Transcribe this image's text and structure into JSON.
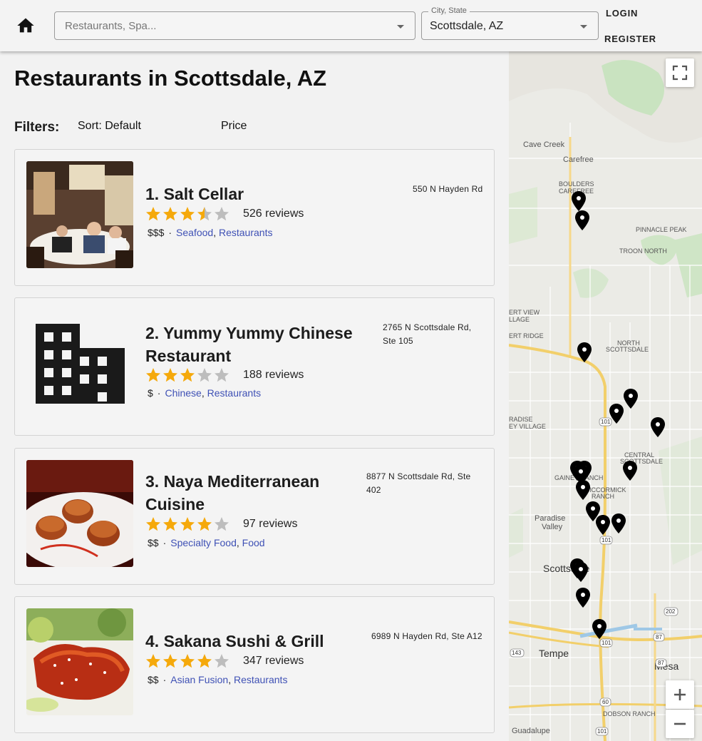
{
  "header": {
    "home_icon": "home-icon",
    "search": {
      "placeholder": "Restaurants, Spa...",
      "value": ""
    },
    "city": {
      "label": "City, State",
      "value": "Scottsdale, AZ"
    },
    "login": "LOGIN",
    "register": "REGISTER"
  },
  "main": {
    "title": "Restaurants in Scottsdale, AZ",
    "filters_label": "Filters:",
    "sort_label": "Sort: Default",
    "price_label": "Price"
  },
  "colors": {
    "star_filled": "#f5a90b",
    "star_empty": "#bdbdbd",
    "link": "#3f51b5",
    "marker": "#000000"
  },
  "results": [
    {
      "name": "1. Salt Cellar",
      "rating": 3.5,
      "reviews": "526 reviews",
      "price": "$$$",
      "categories": [
        "Seafood",
        "Restaurants"
      ],
      "address_line1": "550 N Hayden Rd",
      "address_line2": "",
      "image": "restaurant-dining-room-photo"
    },
    {
      "name": "2. Yummy Yummy Chinese Restaurant",
      "rating": 3,
      "reviews": "188 reviews",
      "price": "$",
      "categories": [
        "Chinese",
        "Restaurants"
      ],
      "address_line1": "2765 N Scottsdale Rd,",
      "address_line2": "Ste 105",
      "image": "building-icon"
    },
    {
      "name": "3. Naya Mediterranean Cuisine",
      "rating": 4,
      "reviews": "97 reviews",
      "price": "$$",
      "categories": [
        "Specialty Food",
        "Food"
      ],
      "address_line1": "8877 N Scottsdale Rd, Ste",
      "address_line2": "402",
      "image": "scallops-dish-photo"
    },
    {
      "name": "4. Sakana Sushi & Grill",
      "rating": 4,
      "reviews": "347 reviews",
      "price": "$$",
      "categories": [
        "Asian Fusion",
        "Restaurants"
      ],
      "address_line1": "6989 N Hayden Rd, Ste A12",
      "address_line2": "",
      "image": "glazed-salmon-salad-photo"
    }
  ],
  "map": {
    "place_labels": [
      "Cave Creek",
      "Carefree",
      "BOULDERS",
      "CAREFREE",
      "PINNACLE PEAK",
      "TROON NORTH",
      "ERT VIEW",
      "LLAGE",
      "ERT RIDGE",
      "NORTH",
      "SCOTTSDALE",
      "RADISE",
      "EY VILLAGE",
      "CENTRAL",
      "SCOTTSDALE",
      "GAINEY RANCH",
      "MCCORMICK",
      "RANCH",
      "Paradise",
      "Valley",
      "Scottsdale",
      "Tempe",
      "Mesa",
      "DOBSON RANCH",
      "Guadalupe"
    ],
    "highway_labels": [
      "101",
      "101",
      "202",
      "87",
      "87",
      "143",
      "60",
      "101",
      "101"
    ],
    "fullscreen_icon": "fullscreen-icon",
    "zoom_in_icon": "plus-icon",
    "zoom_out_icon": "minus-icon",
    "marker_count": 20
  }
}
